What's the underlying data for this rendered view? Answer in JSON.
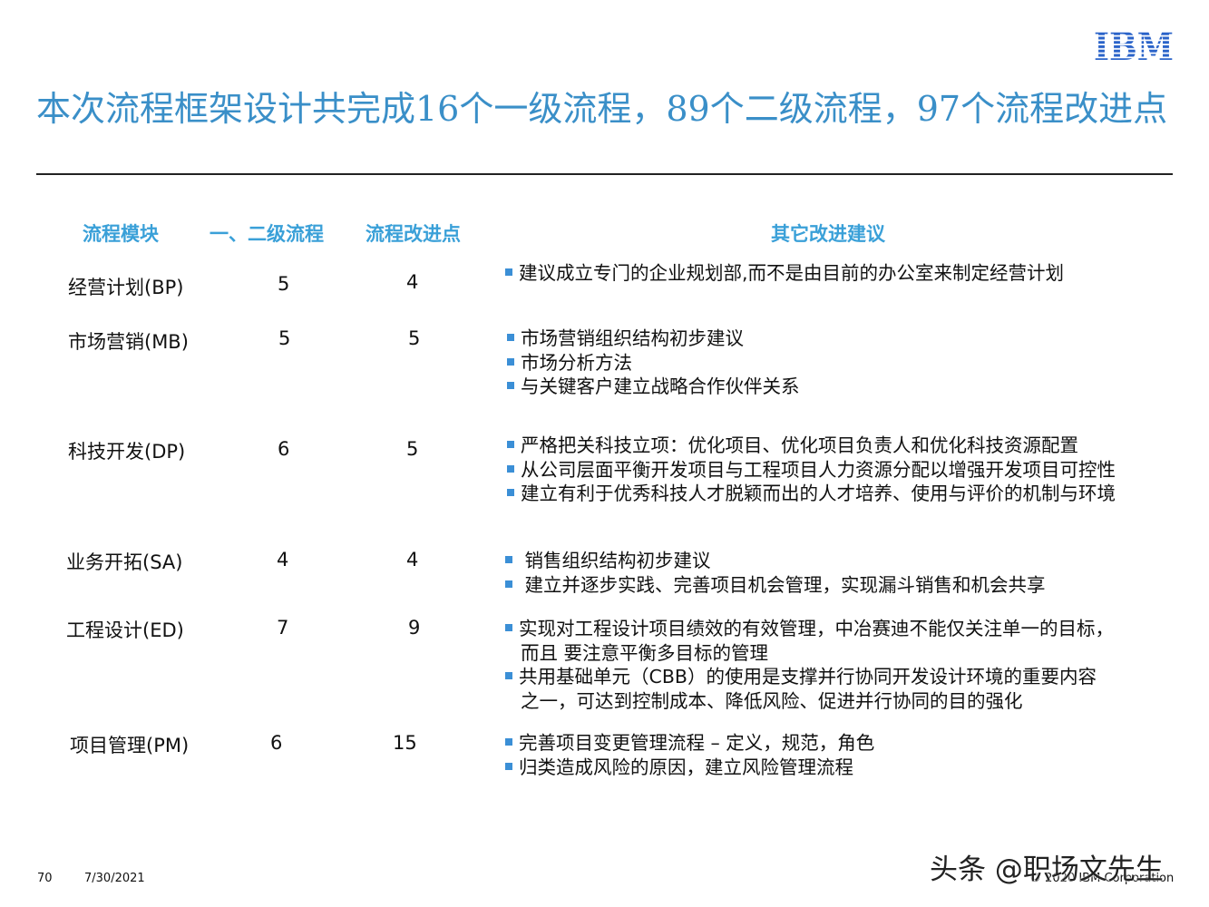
{
  "logo": {
    "text": "IBM",
    "color": "#2a63c9"
  },
  "title": "本次流程框架设计共完成16个一级流程，89个二级流程，97个流程改进点",
  "headers": {
    "module": "流程模块",
    "level2": "一、二级流程",
    "improve": "流程改进点",
    "other": "其它改进建议"
  },
  "rows": [
    {
      "module": "经营计划(BP)",
      "level2": "5",
      "improve": "4",
      "suggestions": [
        [
          "建议成立专门的企业规划部,而不是由目前的办公室来制定经营计划"
        ]
      ]
    },
    {
      "module": "市场营销(MB)",
      "level2": "5",
      "improve": "5",
      "suggestions": [
        [
          "市场营销组织结构初步建议"
        ],
        [
          "市场分析方法"
        ],
        [
          "与关键客户建立战略合作伙伴关系"
        ]
      ]
    },
    {
      "module": "科技开发(DP)",
      "level2": "6",
      "improve": "5",
      "suggestions": [
        [
          "严格把关科技立项：优化项目、优化项目负责人和优化科技资源配置"
        ],
        [
          "从公司层面平衡开发项目与工程项目人力资源分配以增强开发项目可控性"
        ],
        [
          "建立有利于优秀科技人才脱颖而出的人才培养、使用与评价的机制与环境"
        ]
      ]
    },
    {
      "module": "业务开拓(SA)",
      "level2": "4",
      "improve": "4",
      "suggestions": [
        [
          " 销售组织结构初步建议"
        ],
        [
          " 建立并逐步实践、完善项目机会管理，实现漏斗销售和机会共享"
        ]
      ]
    },
    {
      "module": "工程设计(ED)",
      "level2": "7",
      "improve": "9",
      "suggestions": [
        [
          "实现对工程设计项目绩效的有效管理，中冶赛迪不能仅关注单一的目标，",
          "而且   要注意平衡多目标的管理"
        ],
        [
          "共用基础单元（CBB）的使用是支撑并行协同开发设计环境的重要内容",
          "之一，可达到控制成本、降低风险、促进并行协同的目的强化"
        ]
      ]
    },
    {
      "module": "项目管理(PM)",
      "level2": "6",
      "improve": "15",
      "suggestions": [
        [
          "完善项目变更管理流程 – 定义，规范，角色"
        ],
        [
          "归类造成风险的原因，建立风险管理流程"
        ]
      ]
    }
  ],
  "footer": {
    "page": "70",
    "date": "7/30/2021",
    "copyright": "© 2020 IBM Corporation"
  },
  "watermark": "头条 @职场文先生",
  "colors": {
    "title": "#3a8fc8",
    "header": "#3aa0d8",
    "bullet": "#3b8fd6"
  }
}
